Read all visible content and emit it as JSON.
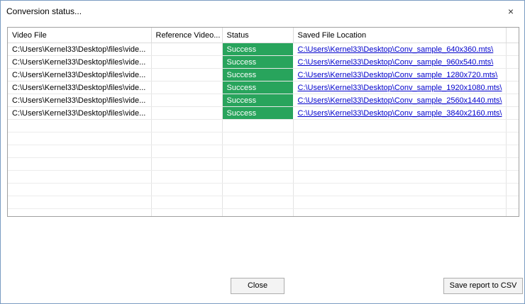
{
  "window": {
    "title": "Conversion status...",
    "close_glyph": "×"
  },
  "grid": {
    "columns": [
      "Video File",
      "Reference Video...",
      "Status",
      "Saved File Location"
    ],
    "rows": [
      {
        "video_file": "C:\\Users\\Kernel33\\Desktop\\files\\vide...",
        "reference": "",
        "status": "Success",
        "location": "C:\\Users\\Kernel33\\Desktop\\Conv_sample_640x360.mts\\"
      },
      {
        "video_file": "C:\\Users\\Kernel33\\Desktop\\files\\vide...",
        "reference": "",
        "status": "Success",
        "location": "C:\\Users\\Kernel33\\Desktop\\Conv_sample_960x540.mts\\"
      },
      {
        "video_file": "C:\\Users\\Kernel33\\Desktop\\files\\vide...",
        "reference": "",
        "status": "Success",
        "location": "C:\\Users\\Kernel33\\Desktop\\Conv_sample_1280x720.mts\\"
      },
      {
        "video_file": "C:\\Users\\Kernel33\\Desktop\\files\\vide...",
        "reference": "",
        "status": "Success",
        "location": "C:\\Users\\Kernel33\\Desktop\\Conv_sample_1920x1080.mts\\"
      },
      {
        "video_file": "C:\\Users\\Kernel33\\Desktop\\files\\vide...",
        "reference": "",
        "status": "Success",
        "location": "C:\\Users\\Kernel33\\Desktop\\Conv_sample_2560x1440.mts\\"
      },
      {
        "video_file": "C:\\Users\\Kernel33\\Desktop\\files\\vide...",
        "reference": "",
        "status": "Success",
        "location": "C:\\Users\\Kernel33\\Desktop\\Conv_sample_3840x2160.mts\\"
      }
    ],
    "status_color": "#28a45c",
    "link_color": "#0000cc"
  },
  "buttons": {
    "close_label": "Close",
    "save_csv_label": "Save report to CSV"
  }
}
